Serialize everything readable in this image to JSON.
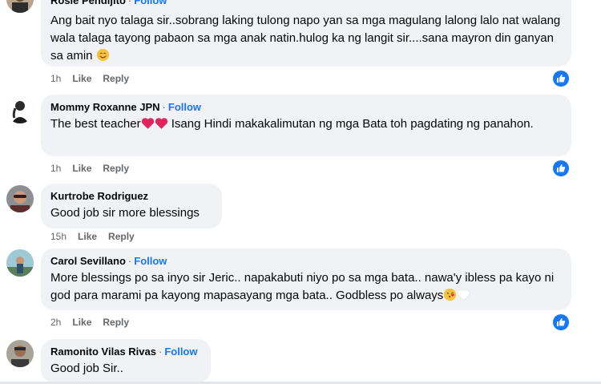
{
  "comments": [
    {
      "author": "Rosie Pendijito",
      "follow": "Follow",
      "text": "Ang bait nyo talaga sir..sobrang laking tulong napo yan sa mga magulang lalong lalo nat walang wala talaga tayong pabaon sa mga anak natin.hulog ka ng langit sir....sana mayron din ganyan sa amin",
      "time": "1h",
      "like": "Like",
      "reply": "Reply"
    },
    {
      "author": "Mommy Roxanne JPN",
      "follow": "Follow",
      "text_a": "The best teacher",
      "text_b": " Isang Hindi makakalimutan ng mga Bata toh pagdating ng panahon.",
      "time": "1h",
      "like": "Like",
      "reply": "Reply"
    },
    {
      "author": "Kurtrobe Rodriguez",
      "text": "Good job sir more blessings",
      "time": "15h",
      "like": "Like",
      "reply": "Reply"
    },
    {
      "author": "Carol Sevillano",
      "follow": "Follow",
      "text": "More blessings po sa inyo sir Jeric.. napakabuti niyo po sa mga bata.. nawa'y ibless pa kayo ni god para marami pa kayong mapasayang mga bata.. Godbless po always",
      "time": "2h",
      "like": "Like",
      "reply": "Reply"
    },
    {
      "author": "Ramonito Vilas Rivas",
      "follow": "Follow",
      "text": "Good job Sir..",
      "time": "",
      "like": "",
      "reply": ""
    }
  ],
  "colors": {
    "accent": "#1877f2",
    "bubble": "#f0f2f5",
    "meta": "#65676b"
  },
  "icons": {
    "reaction": "thumbs-up-icon",
    "heart": "heart-emoji-icon",
    "smile": "smiling-face-emoji-icon",
    "kiss": "face-blowing-kiss-emoji-icon"
  }
}
